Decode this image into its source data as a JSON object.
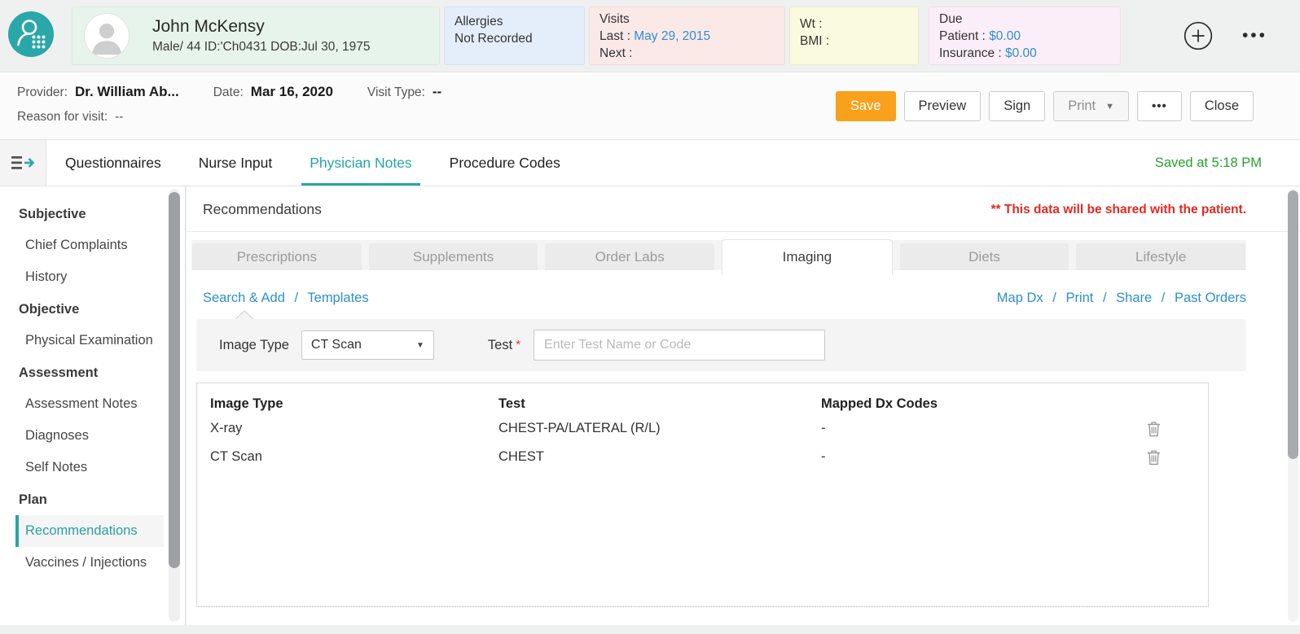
{
  "colors": {
    "accent_teal": "#28a5a6",
    "save_orange": "#f9a11b",
    "link_blue": "#2e8fce",
    "saved_green": "#27a02e",
    "alert_red": "#e02b22"
  },
  "icons": {
    "dropdown_caret": "▼",
    "print_caret": "▼",
    "more_dots": "•••",
    "slash": "/"
  },
  "header": {
    "patient": {
      "name": "John McKensy",
      "details": "Male/ 44 ID:'Ch0431 DOB:Jul 30, 1975"
    },
    "allergies": {
      "title": "Allergies",
      "value": "Not Recorded"
    },
    "visits": {
      "title": "Visits",
      "last_label": "Last :",
      "last_value": "May 29, 2015",
      "next_label": "Next :",
      "next_value": ""
    },
    "vitals": {
      "wt_label": "Wt :",
      "wt_value": "",
      "bmi_label": "BMI :",
      "bmi_value": ""
    },
    "due": {
      "title": "Due",
      "patient_label": "Patient :",
      "patient_value": "$0.00",
      "insurance_label": "Insurance :",
      "insurance_value": "$0.00"
    }
  },
  "encounter": {
    "provider_label": "Provider:",
    "provider_value": "Dr. William Ab...",
    "date_label": "Date:",
    "date_value": "Mar 16, 2020",
    "visit_type_label": "Visit Type:",
    "visit_type_value": "--",
    "reason_label": "Reason for visit:",
    "reason_value": "--",
    "buttons": {
      "save": "Save",
      "preview": "Preview",
      "sign": "Sign",
      "print": "Print",
      "close": "Close"
    }
  },
  "tabs": {
    "items": [
      "Questionnaires",
      "Nurse Input",
      "Physician Notes",
      "Procedure Codes"
    ],
    "active_tab": "Physician Notes",
    "saved_status": "Saved at 5:18 PM"
  },
  "sidebar": {
    "sections": [
      {
        "title": "Subjective",
        "items": [
          "Chief Complaints",
          "History"
        ]
      },
      {
        "title": "Objective",
        "items": [
          "Physical Examination"
        ]
      },
      {
        "title": "Assessment",
        "items": [
          "Assessment Notes",
          "Diagnoses",
          "Self Notes"
        ]
      },
      {
        "title": "Plan",
        "items": [
          "Recommendations",
          "Vaccines / Injections"
        ]
      }
    ],
    "selected_item": "Recommendations"
  },
  "main": {
    "title": "Recommendations",
    "share_note": "** This data will be shared with the patient.",
    "subtabs": [
      "Prescriptions",
      "Supplements",
      "Order Labs",
      "Imaging",
      "Diets",
      "Lifestyle"
    ],
    "active_subtab": "Imaging",
    "left_links": [
      "Search & Add",
      "Templates"
    ],
    "right_links": [
      "Map Dx",
      "Print",
      "Share",
      "Past Orders"
    ],
    "form": {
      "image_type_label": "Image Type",
      "image_type_value": "CT Scan",
      "test_label": "Test",
      "required_mark": "*",
      "test_placeholder": "Enter Test Name or Code"
    },
    "table": {
      "headers": [
        "Image Type",
        "Test",
        "Mapped Dx Codes"
      ],
      "rows": [
        {
          "image_type": "X-ray",
          "test": "CHEST-PA/LATERAL (R/L)",
          "mapped_dx": "-"
        },
        {
          "image_type": "CT Scan",
          "test": "CHEST",
          "mapped_dx": "-"
        }
      ]
    }
  }
}
